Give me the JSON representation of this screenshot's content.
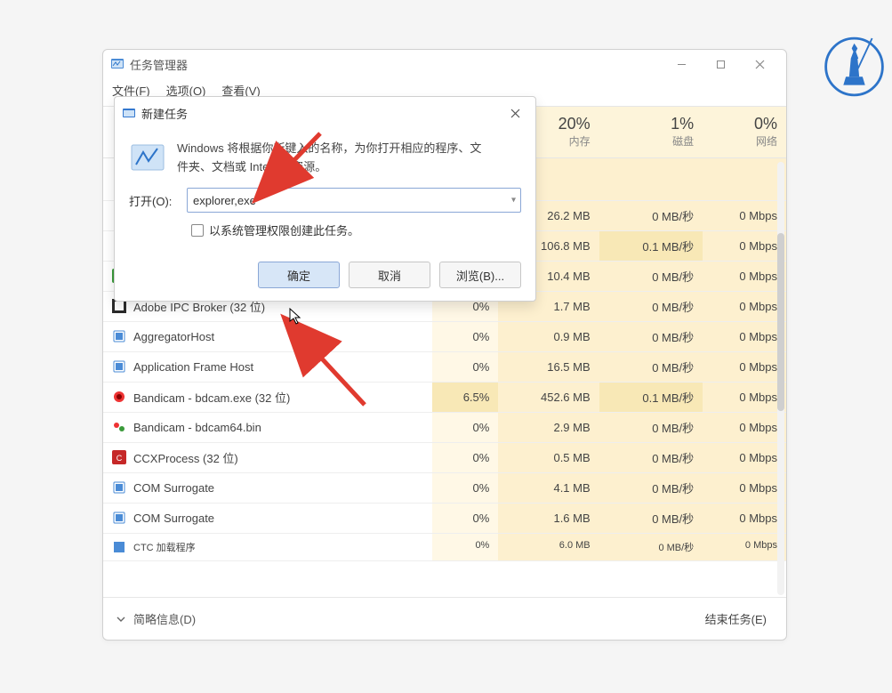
{
  "window": {
    "title": "任务管理器",
    "minimize": "—",
    "maximize": "☐",
    "close": "✕"
  },
  "menu": {
    "file": "文件(F)",
    "options": "选项(O)",
    "view": "查看(V)"
  },
  "headers": {
    "name": "",
    "cpu_pct": "",
    "mem_pct": "20%",
    "disk_pct": "1%",
    "net_pct": "0%",
    "cpu_label": "",
    "mem_label": "内存",
    "disk_label": "磁盘",
    "net_label": "网络"
  },
  "rows": [
    {
      "name": "",
      "cpu": "",
      "mem": "26.2 MB",
      "disk": "0 MB/秒",
      "net": "0 Mbps",
      "icon": "blank"
    },
    {
      "name": "",
      "cpu": "",
      "mem": "106.8 MB",
      "disk": "0.1 MB/秒",
      "net": "0 Mbps",
      "icon": "blank",
      "disk_hi": true
    },
    {
      "name": "",
      "cpu": "",
      "mem": "10.4 MB",
      "disk": "0 MB/秒",
      "net": "0 Mbps",
      "icon": "green"
    },
    {
      "name": "Adobe IPC Broker (32 位)",
      "cpu": "0%",
      "mem": "1.7 MB",
      "disk": "0 MB/秒",
      "net": "0 Mbps",
      "icon": "adobe"
    },
    {
      "name": "AggregatorHost",
      "cpu": "0%",
      "mem": "0.9 MB",
      "disk": "0 MB/秒",
      "net": "0 Mbps",
      "icon": "generic"
    },
    {
      "name": "Application Frame Host",
      "cpu": "0%",
      "mem": "16.5 MB",
      "disk": "0 MB/秒",
      "net": "0 Mbps",
      "icon": "generic"
    },
    {
      "name": "Bandicam - bdcam.exe (32 位)",
      "cpu": "6.5%",
      "mem": "452.6 MB",
      "disk": "0.1 MB/秒",
      "net": "0 Mbps",
      "icon": "bandicam",
      "cpu_hi": true,
      "disk_hi": true
    },
    {
      "name": "Bandicam - bdcam64.bin",
      "cpu": "0%",
      "mem": "2.9 MB",
      "disk": "0 MB/秒",
      "net": "0 Mbps",
      "icon": "bandicam2"
    },
    {
      "name": "CCXProcess (32 位)",
      "cpu": "0%",
      "mem": "0.5 MB",
      "disk": "0 MB/秒",
      "net": "0 Mbps",
      "icon": "ccx"
    },
    {
      "name": "COM Surrogate",
      "cpu": "0%",
      "mem": "4.1 MB",
      "disk": "0 MB/秒",
      "net": "0 Mbps",
      "icon": "generic"
    },
    {
      "name": "COM Surrogate",
      "cpu": "0%",
      "mem": "1.6 MB",
      "disk": "0 MB/秒",
      "net": "0 Mbps",
      "icon": "generic"
    },
    {
      "name": "CTC 加载程序",
      "cpu": "0%",
      "mem": "6.0 MB",
      "disk": "0 MB/秒",
      "net": "0 Mbps",
      "icon": "ctc",
      "cutoff": true
    }
  ],
  "status": {
    "brief": "简略信息(D)",
    "end_task": "结束任务(E)"
  },
  "dialog": {
    "title": "新建任务",
    "desc1": "Windows 将根据你所键入的名称，为你打开相应的程序、文",
    "desc2": "件夹、文档或 Internet 资源。",
    "openLabel": "打开(O):",
    "inputValue": "explorer,exe",
    "checkboxLabel": "以系统管理权限创建此任务。",
    "okLabel": "确定",
    "cancelLabel": "取消",
    "browseLabel": "浏览(B)..."
  }
}
